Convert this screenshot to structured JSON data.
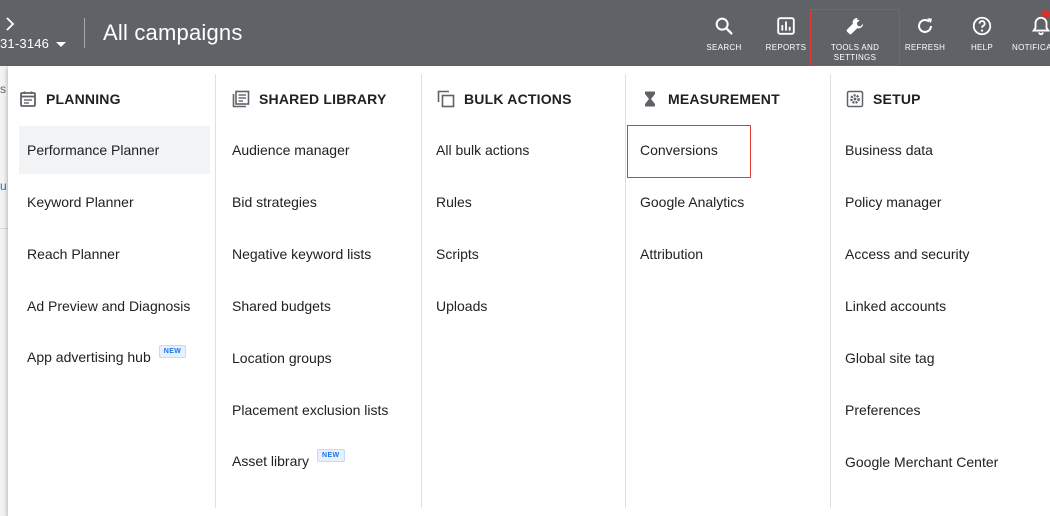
{
  "header": {
    "account_id": "31-3146",
    "title": "All campaigns",
    "buttons": [
      {
        "id": "search",
        "icon": "search-icon",
        "label": "SEARCH"
      },
      {
        "id": "reports",
        "icon": "reports-icon",
        "label": "REPORTS"
      },
      {
        "id": "tools",
        "icon": "wrench-icon",
        "label": "TOOLS AND SETTINGS"
      },
      {
        "id": "refresh",
        "icon": "refresh-icon",
        "label": "REFRESH"
      },
      {
        "id": "help",
        "icon": "help-icon",
        "label": "HELP"
      },
      {
        "id": "notifications",
        "icon": "bell-icon",
        "label": "NOTIFICATIONS"
      }
    ]
  },
  "behind": {
    "letter_s": "s",
    "letter_u": "u"
  },
  "menu": {
    "columns": [
      {
        "id": "planning",
        "icon": "calendar-icon",
        "heading": "PLANNING",
        "items": [
          {
            "label": "Performance Planner",
            "selected": true
          },
          {
            "label": "Keyword Planner"
          },
          {
            "label": "Reach Planner"
          },
          {
            "label": "Ad Preview and Diagnosis"
          },
          {
            "label": "App advertising hub",
            "badge": "NEW"
          }
        ]
      },
      {
        "id": "shared-library",
        "icon": "library-icon",
        "heading": "SHARED LIBRARY",
        "items": [
          {
            "label": "Audience manager"
          },
          {
            "label": "Bid strategies"
          },
          {
            "label": "Negative keyword lists"
          },
          {
            "label": "Shared budgets"
          },
          {
            "label": "Location groups"
          },
          {
            "label": "Placement exclusion lists"
          },
          {
            "label": "Asset library",
            "badge": "NEW"
          }
        ]
      },
      {
        "id": "bulk-actions",
        "icon": "copy-icon",
        "heading": "BULK ACTIONS",
        "items": [
          {
            "label": "All bulk actions"
          },
          {
            "label": "Rules"
          },
          {
            "label": "Scripts"
          },
          {
            "label": "Uploads"
          }
        ]
      },
      {
        "id": "measurement",
        "icon": "hourglass-icon",
        "heading": "MEASUREMENT",
        "items": [
          {
            "label": "Conversions"
          },
          {
            "label": "Google Analytics"
          },
          {
            "label": "Attribution"
          }
        ]
      },
      {
        "id": "setup",
        "icon": "gear-icon",
        "heading": "SETUP",
        "items": [
          {
            "label": "Business data"
          },
          {
            "label": "Policy manager"
          },
          {
            "label": "Access and security"
          },
          {
            "label": "Linked accounts"
          },
          {
            "label": "Global site tag"
          },
          {
            "label": "Preferences"
          },
          {
            "label": "Google Merchant Center"
          }
        ]
      }
    ]
  },
  "colors": {
    "header_bg": "#5f6368",
    "highlight": "#e53935",
    "badge_text": "#1a73e8",
    "selected_bg": "#f1f3f4"
  }
}
